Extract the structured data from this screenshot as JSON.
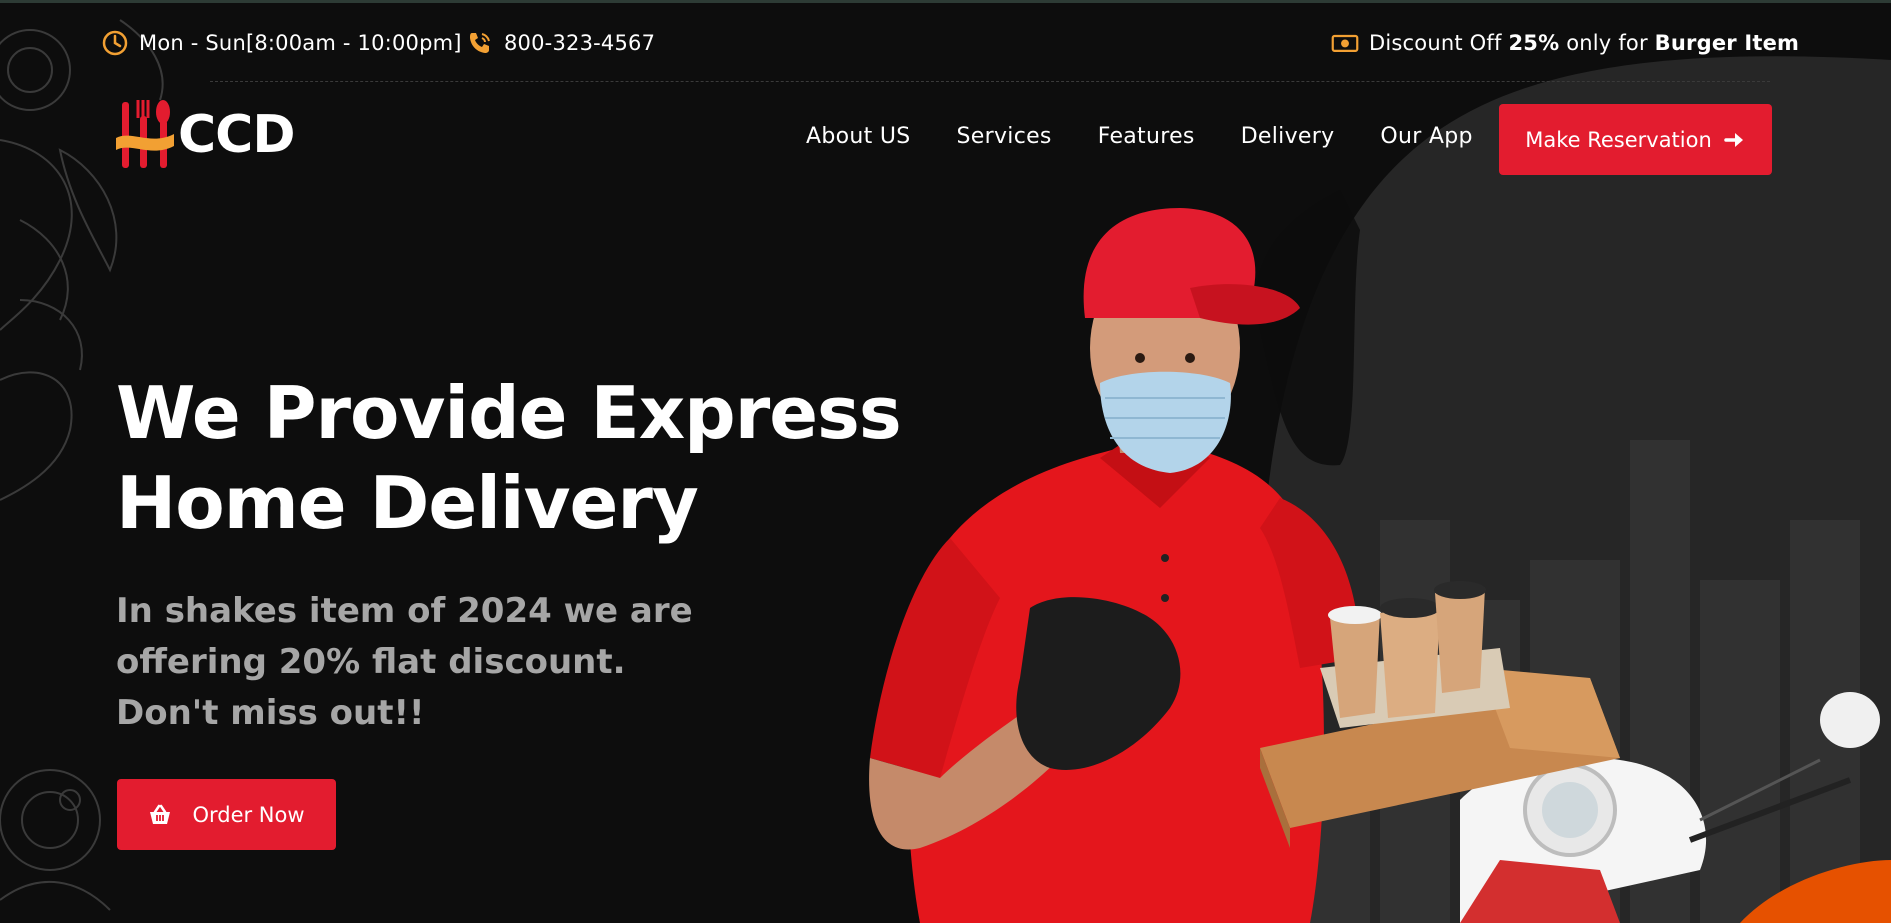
{
  "topbar": {
    "hours": "Mon - Sun[8:00am - 10:00pm]",
    "phone": "800-323-4567",
    "discount_prefix": "Discount Off ",
    "discount_value": "25%",
    "discount_mid": " only for ",
    "discount_item": "Burger Item"
  },
  "logo": {
    "text": "CCD"
  },
  "nav": {
    "items": [
      "About US",
      "Services",
      "Features",
      "Delivery",
      "Our App"
    ],
    "cta": "Make Reservation"
  },
  "hero": {
    "title_line1": "We Provide Express",
    "title_line2": "Home Delivery",
    "subtitle": "In shakes item of 2024 we are offering 20% flat discount. Don't miss out!!",
    "order_button": "Order Now"
  },
  "colors": {
    "background": "#0d0d0d",
    "accent_red": "#e31c2f",
    "accent_orange": "#f2a033",
    "muted_text": "#a6a6a6"
  },
  "icons": {
    "hours": "clock-icon",
    "phone": "phone-icon",
    "discount": "money-icon",
    "cta": "arrow-right-icon",
    "order": "basket-icon"
  }
}
